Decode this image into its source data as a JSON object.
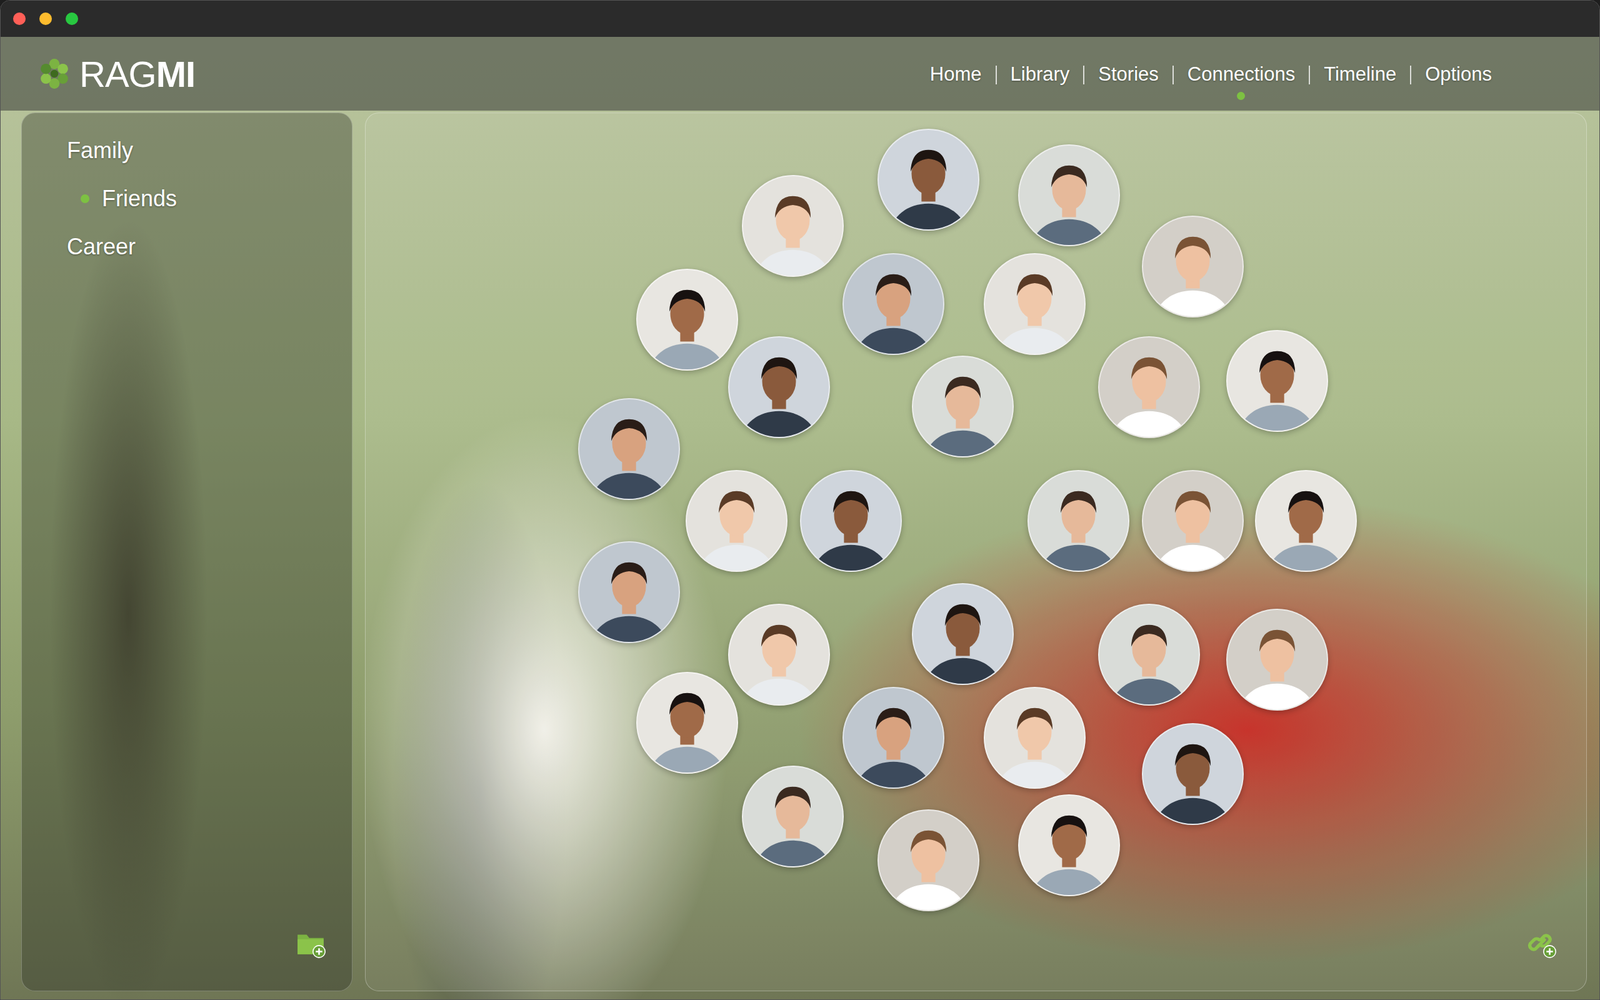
{
  "window": {
    "controls": [
      {
        "name": "close",
        "color": "#ff5f57"
      },
      {
        "name": "minimize",
        "color": "#febc2e"
      },
      {
        "name": "zoom",
        "color": "#28c840"
      }
    ]
  },
  "logo": {
    "light": "RAG",
    "bold": "MI"
  },
  "nav": [
    {
      "label": "Home",
      "selected": false
    },
    {
      "label": "Library",
      "selected": false
    },
    {
      "label": "Stories",
      "selected": false
    },
    {
      "label": "Connections",
      "selected": true
    },
    {
      "label": "Timeline",
      "selected": false
    },
    {
      "label": "Options",
      "selected": false
    }
  ],
  "sidebar": {
    "items": [
      {
        "label": "Family",
        "selected": false
      },
      {
        "label": "Friends",
        "selected": true
      },
      {
        "label": "Career",
        "selected": false
      }
    ]
  }
}
